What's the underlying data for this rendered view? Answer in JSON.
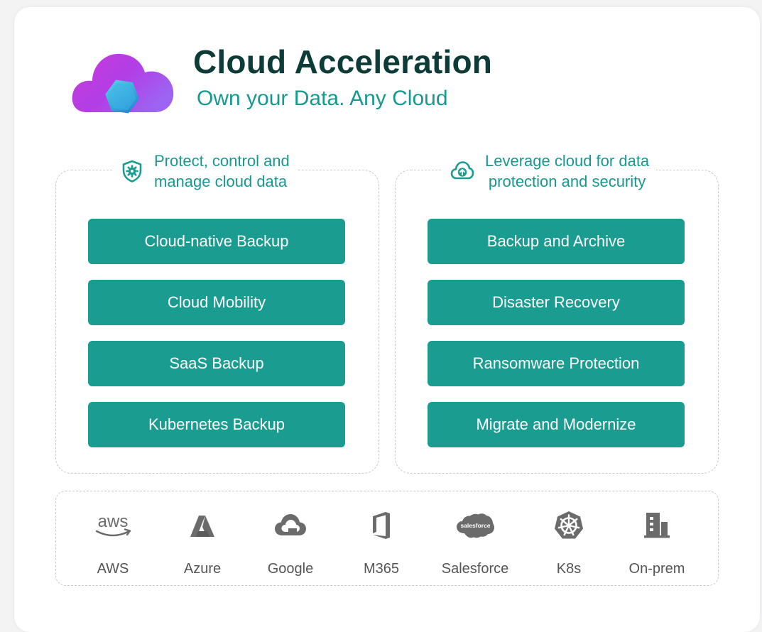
{
  "header": {
    "title": "Cloud Acceleration",
    "subtitle": "Own your Data. Any Cloud",
    "logo_icon": "cloud-hexagon-logo"
  },
  "left_panel": {
    "icon": "shield-gear-icon",
    "heading_line1": "Protect, control and",
    "heading_line2": "manage cloud data",
    "items": [
      {
        "label": "Cloud-native Backup"
      },
      {
        "label": "Cloud Mobility"
      },
      {
        "label": "SaaS Backup"
      },
      {
        "label": "Kubernetes Backup"
      }
    ]
  },
  "right_panel": {
    "icon": "cloud-upload-icon",
    "heading_line1": "Leverage cloud for data",
    "heading_line2": "protection and security",
    "items": [
      {
        "label": "Backup and Archive"
      },
      {
        "label": "Disaster Recovery"
      },
      {
        "label": "Ransomware Protection"
      },
      {
        "label": "Migrate and Modernize"
      }
    ]
  },
  "platforms": [
    {
      "label": "AWS",
      "icon": "aws-icon",
      "icon_text": "aws"
    },
    {
      "label": "Azure",
      "icon": "azure-icon"
    },
    {
      "label": "Google",
      "icon": "google-cloud-icon"
    },
    {
      "label": "M365",
      "icon": "m365-icon"
    },
    {
      "label": "Salesforce",
      "icon": "salesforce-icon",
      "icon_text": "salesforce"
    },
    {
      "label": "K8s",
      "icon": "kubernetes-icon"
    },
    {
      "label": "On-prem",
      "icon": "building-icon"
    }
  ],
  "colors": {
    "accent": "#1a9c91",
    "title": "#0d3b38",
    "teal_text": "#17998f",
    "icon_gray": "#6b6b6b",
    "border": "#c9c9c9"
  }
}
